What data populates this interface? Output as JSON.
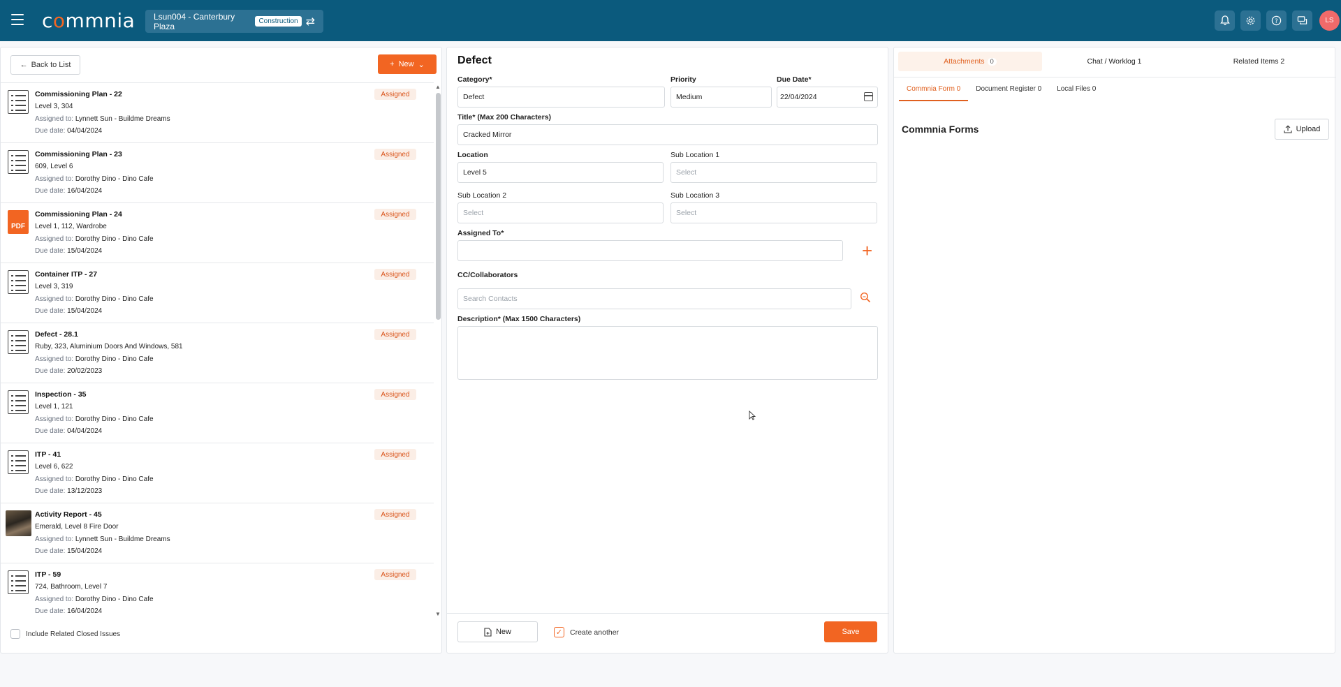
{
  "header": {
    "logo_text": "commnia",
    "project_name": "Lsun004 - Canterbury Plaza",
    "project_badge": "Construction",
    "avatar_initials": "LS"
  },
  "left": {
    "back_label": "Back to List",
    "new_label": "New",
    "items": [
      {
        "title": "Commissioning Plan - 22",
        "location": "Level 3, 304",
        "assigned_label": "Assigned to:",
        "assigned": "Lynnett Sun - Buildme Dreams",
        "due_label": "Due date:",
        "due": "04/04/2024",
        "status": "Assigned",
        "thumb": "checklist"
      },
      {
        "title": "Commissioning Plan - 23",
        "location": "609, Level 6",
        "assigned_label": "Assigned to:",
        "assigned": "Dorothy Dino - Dino Cafe",
        "due_label": "Due date:",
        "due": "16/04/2024",
        "status": "Assigned",
        "thumb": "checklist"
      },
      {
        "title": "Commissioning Plan - 24",
        "location": "Level 1, 112, Wardrobe",
        "assigned_label": "Assigned to:",
        "assigned": "Dorothy Dino - Dino Cafe",
        "due_label": "Due date:",
        "due": "15/04/2024",
        "status": "Assigned",
        "thumb": "pdf",
        "thumb_text": "PDF"
      },
      {
        "title": "Container ITP - 27",
        "location": "Level 3, 319",
        "assigned_label": "Assigned to:",
        "assigned": "Dorothy Dino - Dino Cafe",
        "due_label": "Due date:",
        "due": "15/04/2024",
        "status": "Assigned",
        "thumb": "checklist"
      },
      {
        "title": "Defect - 28.1",
        "location": "Ruby, 323, Aluminium Doors And Windows, 581",
        "assigned_label": "Assigned to:",
        "assigned": "Dorothy Dino - Dino Cafe",
        "due_label": "Due date:",
        "due": "20/02/2023",
        "status": "Assigned",
        "thumb": "checklist"
      },
      {
        "title": "Inspection - 35",
        "location": "Level 1, 121",
        "assigned_label": "Assigned to:",
        "assigned": "Dorothy Dino - Dino Cafe",
        "due_label": "Due date:",
        "due": "04/04/2024",
        "status": "Assigned",
        "thumb": "checklist"
      },
      {
        "title": "ITP - 41",
        "location": "Level 6, 622",
        "assigned_label": "Assigned to:",
        "assigned": "Dorothy Dino - Dino Cafe",
        "due_label": "Due date:",
        "due": "13/12/2023",
        "status": "Assigned",
        "thumb": "checklist"
      },
      {
        "title": "Activity Report - 45",
        "location": "Emerald, Level 8 Fire Door",
        "assigned_label": "Assigned to:",
        "assigned": "Lynnett Sun - Buildme Dreams",
        "due_label": "Due date:",
        "due": "15/04/2024",
        "status": "Assigned",
        "thumb": "photo"
      },
      {
        "title": "ITP - 59",
        "location": "724, Bathroom, Level 7",
        "assigned_label": "Assigned to:",
        "assigned": "Dorothy Dino - Dino Cafe",
        "due_label": "Due date:",
        "due": "16/04/2024",
        "status": "Assigned",
        "thumb": "checklist"
      }
    ],
    "include_closed_label": "Include Related Closed Issues"
  },
  "form": {
    "title": "Defect",
    "category_label": "Category*",
    "category_value": "Defect",
    "priority_label": "Priority",
    "priority_value": "Medium",
    "due_label": "Due Date*",
    "due_value": "22/04/2024",
    "title_label": "Title* (Max 200 Characters)",
    "title_value": "Cracked Mirror",
    "location_label": "Location",
    "location_value": "Level 5",
    "sub1_label": "Sub Location 1",
    "sub1_placeholder": "Select",
    "sub2_label": "Sub Location 2",
    "sub2_placeholder": "Select",
    "sub3_label": "Sub Location 3",
    "sub3_placeholder": "Select",
    "assigned_label": "Assigned To*",
    "assigned_value": "",
    "cc_label": "CC/Collaborators",
    "cc_placeholder": "Search Contacts",
    "desc_label": "Description* (Max 1500 Characters)",
    "desc_value": "",
    "new_label": "New",
    "create_another_label": "Create another",
    "save_label": "Save"
  },
  "right": {
    "tabs": [
      {
        "label": "Attachments",
        "count": "0"
      },
      {
        "label": "Chat / Worklog 1"
      },
      {
        "label": "Related Items 2"
      }
    ],
    "subtabs": [
      "Commnia Form 0",
      "Document Register 0",
      "Local Files 0"
    ],
    "forms_title": "Commnia Forms",
    "upload_label": "Upload"
  },
  "colors": {
    "primary": "#0b5a7d",
    "accent": "#f26522"
  }
}
